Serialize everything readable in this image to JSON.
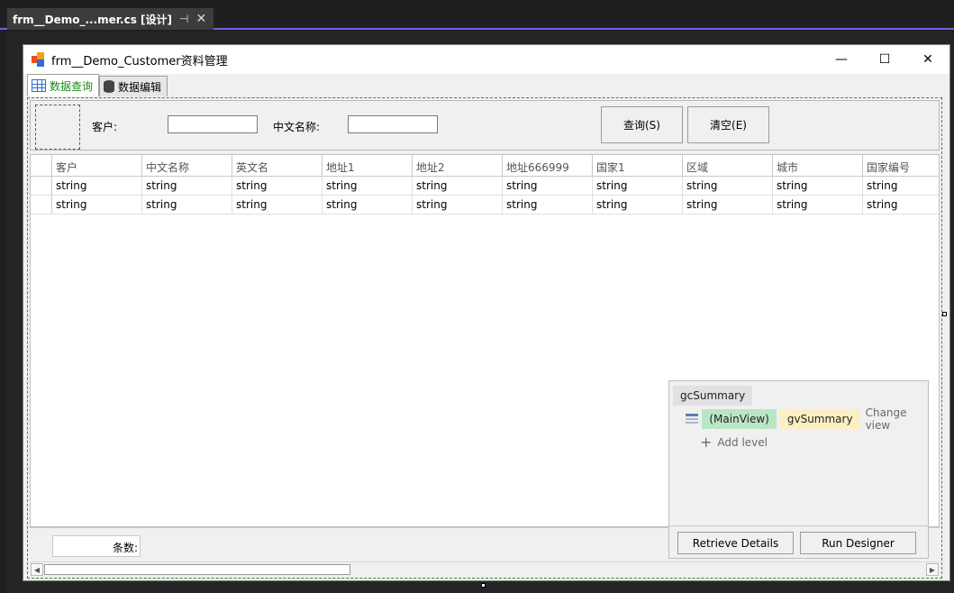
{
  "ide": {
    "doc_tab_title": "frm__Demo_...mer.cs [设计]",
    "pin_glyph": "⊣",
    "close_glyph": "✕"
  },
  "form": {
    "title": "frm__Demo_Customer资料管理",
    "minimize_glyph": "—",
    "maximize_glyph": "☐",
    "close_glyph": "✕",
    "tabs": [
      {
        "label": "数据查询",
        "icon": "grid-icon",
        "active": true
      },
      {
        "label": "数据编辑",
        "icon": "database-icon",
        "active": false
      }
    ]
  },
  "filter": {
    "customer_label": "客户:",
    "customer_value": "",
    "cn_name_label": "中文名称:",
    "cn_name_value": "",
    "query_button": "查询(S)",
    "clear_button": "清空(E)"
  },
  "grid": {
    "columns": [
      "客户",
      "中文名称",
      "英文名",
      "地址1",
      "地址2",
      "地址666999",
      "国家1",
      "区域",
      "城市",
      "国家编号"
    ],
    "rows": [
      [
        "string",
        "string",
        "string",
        "string",
        "string",
        "string",
        "string",
        "string",
        "string",
        "string"
      ],
      [
        "string",
        "string",
        "string",
        "string",
        "string",
        "string",
        "string",
        "string",
        "string",
        "string"
      ]
    ]
  },
  "footer": {
    "count_label": "条数:"
  },
  "scrollbar": {
    "left_arrow": "◀",
    "right_arrow": "▶"
  },
  "level_designer": {
    "title": "gcSummary",
    "main_view": "(MainView)",
    "view_name": "gvSummary",
    "change_view": "Change view",
    "add_level_glyph": "+",
    "add_level": "Add level",
    "retrieve_details": "Retrieve Details",
    "run_designer": "Run Designer"
  }
}
